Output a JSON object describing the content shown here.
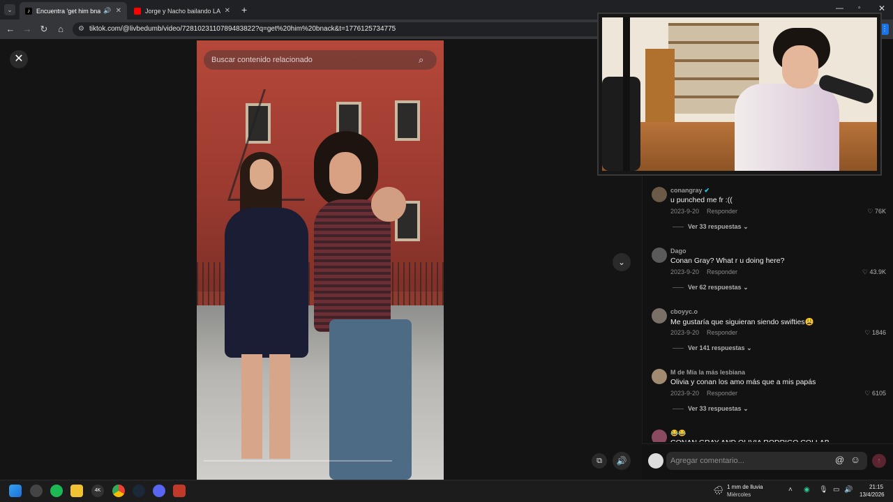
{
  "tabs": [
    {
      "title": "Encuentra 'get him bnack' a",
      "active": true
    },
    {
      "title": "Jorge y Nacho bailando LA MÁ",
      "active": false
    }
  ],
  "address": {
    "url": "tiktok.com/@livbedumb/video/7281023110789483822?q=get%20him%20bnack&t=1776125734775"
  },
  "video": {
    "search_placeholder": "Buscar contenido relacionado",
    "progress": 0.0
  },
  "comments": [
    {
      "user": "conangray",
      "verified": true,
      "text": "u punched me fr :((",
      "date": "2023-9-20",
      "reply": "Responder",
      "likes": "76K",
      "more": "Ver 33 respuestas",
      "avatar_color": "#6b5a48"
    },
    {
      "user": "Dago",
      "verified": false,
      "text": "Conan Gray? What r u doing here?",
      "date": "2023-9-20",
      "reply": "Responder",
      "likes": "43.9K",
      "more": "Ver 62 respuestas",
      "avatar_color": "#5a5a5a"
    },
    {
      "user": "cboyyc.o",
      "verified": false,
      "text": "Me gustaría que siguieran siendo swifties😩",
      "date": "2023-9-20",
      "reply": "Responder",
      "likes": "1846",
      "more": "Ver 141 respuestas",
      "avatar_color": "#7a7068"
    },
    {
      "user": "M de Mía la más lesbiana",
      "verified": false,
      "text": "Olivia y conan los amo más que a mis papás",
      "date": "2023-9-20",
      "reply": "Responder",
      "likes": "6105",
      "more": "Ver 33 respuestas",
      "avatar_color": "#a08a70"
    },
    {
      "user": "😂😂",
      "verified": false,
      "text": "CONAN GRAY AND OLIVIA RODRIGO COLLAB",
      "date": "",
      "reply": "",
      "likes": "",
      "more": "",
      "avatar_color": "#8a4a60"
    }
  ],
  "comment_input": {
    "placeholder": "Agregar comentario..."
  },
  "taskbar": {
    "weather_line1": "1 mm de lluvia",
    "weather_line2": "Miércoles",
    "time": "21:15",
    "date": "13/4/2026"
  },
  "colors": {
    "accent": "#fe2c55",
    "verified": "#20d5ec"
  }
}
